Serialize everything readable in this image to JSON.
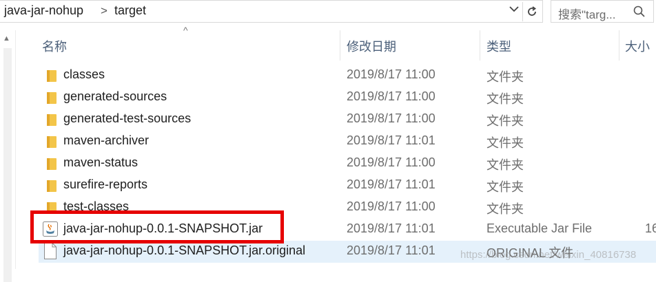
{
  "address_bar": {
    "crumbs": [
      "java-jar-nohup",
      "target"
    ],
    "separator": ">",
    "search_placeholder": "搜索\"targ..."
  },
  "columns": {
    "name": "名称",
    "date": "修改日期",
    "type": "类型",
    "size": "大小"
  },
  "rows": [
    {
      "name": "classes",
      "date": "2019/8/17 11:00",
      "type": "文件夹",
      "icon": "folder-icon"
    },
    {
      "name": "generated-sources",
      "date": "2019/8/17 11:00",
      "type": "文件夹",
      "icon": "folder-icon"
    },
    {
      "name": "generated-test-sources",
      "date": "2019/8/17 11:00",
      "type": "文件夹",
      "icon": "folder-icon"
    },
    {
      "name": "maven-archiver",
      "date": "2019/8/17 11:01",
      "type": "文件夹",
      "icon": "folder-icon"
    },
    {
      "name": "maven-status",
      "date": "2019/8/17 11:00",
      "type": "文件夹",
      "icon": "folder-icon"
    },
    {
      "name": "surefire-reports",
      "date": "2019/8/17 11:01",
      "type": "文件夹",
      "icon": "folder-icon"
    },
    {
      "name": "test-classes",
      "date": "2019/8/17 11:00",
      "type": "文件夹",
      "icon": "folder-icon"
    },
    {
      "name": "java-jar-nohup-0.0.1-SNAPSHOT.jar",
      "date": "2019/8/17 11:01",
      "type": "Executable Jar File",
      "size": "16",
      "icon": "jar-icon"
    },
    {
      "name": "java-jar-nohup-0.0.1-SNAPSHOT.jar.original",
      "date": "2019/8/17 11:01",
      "type": "ORIGINAL 文件",
      "icon": "file-icon"
    }
  ],
  "watermark": "https://blog.csdn.net/weixin_40816738",
  "colors": {
    "highlight": "#e60000",
    "selected_row": "#e5f1fb",
    "folder": "#f3c549"
  }
}
